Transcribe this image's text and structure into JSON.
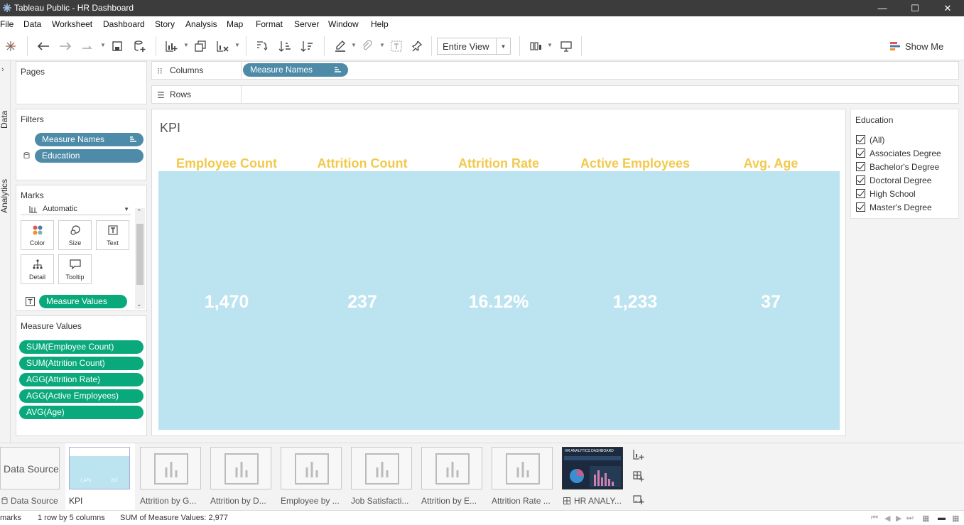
{
  "window": {
    "title": "Tableau Public - HR Dashboard"
  },
  "menu": [
    "File",
    "Data",
    "Worksheet",
    "Dashboard",
    "Story",
    "Analysis",
    "Map",
    "Format",
    "Server",
    "Window",
    "Help"
  ],
  "toolbar": {
    "view_mode": "Entire View",
    "show_me": "Show Me"
  },
  "side_tabs": {
    "data": "Data",
    "analytics": "Analytics"
  },
  "pages": {
    "title": "Pages"
  },
  "filters": {
    "title": "Filters",
    "items": [
      "Measure Names",
      "Education"
    ]
  },
  "marks": {
    "title": "Marks",
    "type": "Automatic",
    "buttons": [
      "Color",
      "Size",
      "Text",
      "Detail",
      "Tooltip"
    ],
    "field": "Measure Values"
  },
  "measure_values": {
    "title": "Measure Values",
    "items": [
      "SUM(Employee Count)",
      "SUM(Attrition Count)",
      "AGG(Attrition Rate)",
      "AGG(Active Employees)",
      "AVG(Age)"
    ]
  },
  "shelves": {
    "columns_label": "Columns",
    "columns_pill": "Measure Names",
    "rows_label": "Rows"
  },
  "view": {
    "sheet_title": "KPI",
    "kpis": [
      {
        "label": "Employee Count",
        "value": "1,470"
      },
      {
        "label": "Attrition Count",
        "value": "237"
      },
      {
        "label": "Attrition Rate",
        "value": "16.12%"
      },
      {
        "label": "Active Employees",
        "value": "1,233"
      },
      {
        "label": "Avg. Age",
        "value": "37"
      }
    ],
    "colors": {
      "background": "#bce3f0",
      "header": "#f2c94c",
      "value": "#ffffff"
    }
  },
  "legend": {
    "title": "Education",
    "items": [
      "(All)",
      "Associates Degree",
      "Bachelor's Degree",
      "Doctoral Degree",
      "High School",
      "Master's Degree"
    ]
  },
  "tabs": {
    "data_source": "Data Source",
    "sheets": [
      "KPI",
      "Attrition by G...",
      "Attrition by D...",
      "Employee by ...",
      "Job Satisfacti...",
      "Attrition by E...",
      "Attrition Rate ...",
      "HR ANALY..."
    ],
    "kpi_thumb_values": [
      "1,470",
      "237"
    ],
    "dashboard_thumb_title": "HR ANALYTICS DASHBOARD"
  },
  "status": {
    "marks": "marks",
    "layout": "1 row by 5 columns",
    "sum": "SUM of Measure Values: 2,977"
  }
}
